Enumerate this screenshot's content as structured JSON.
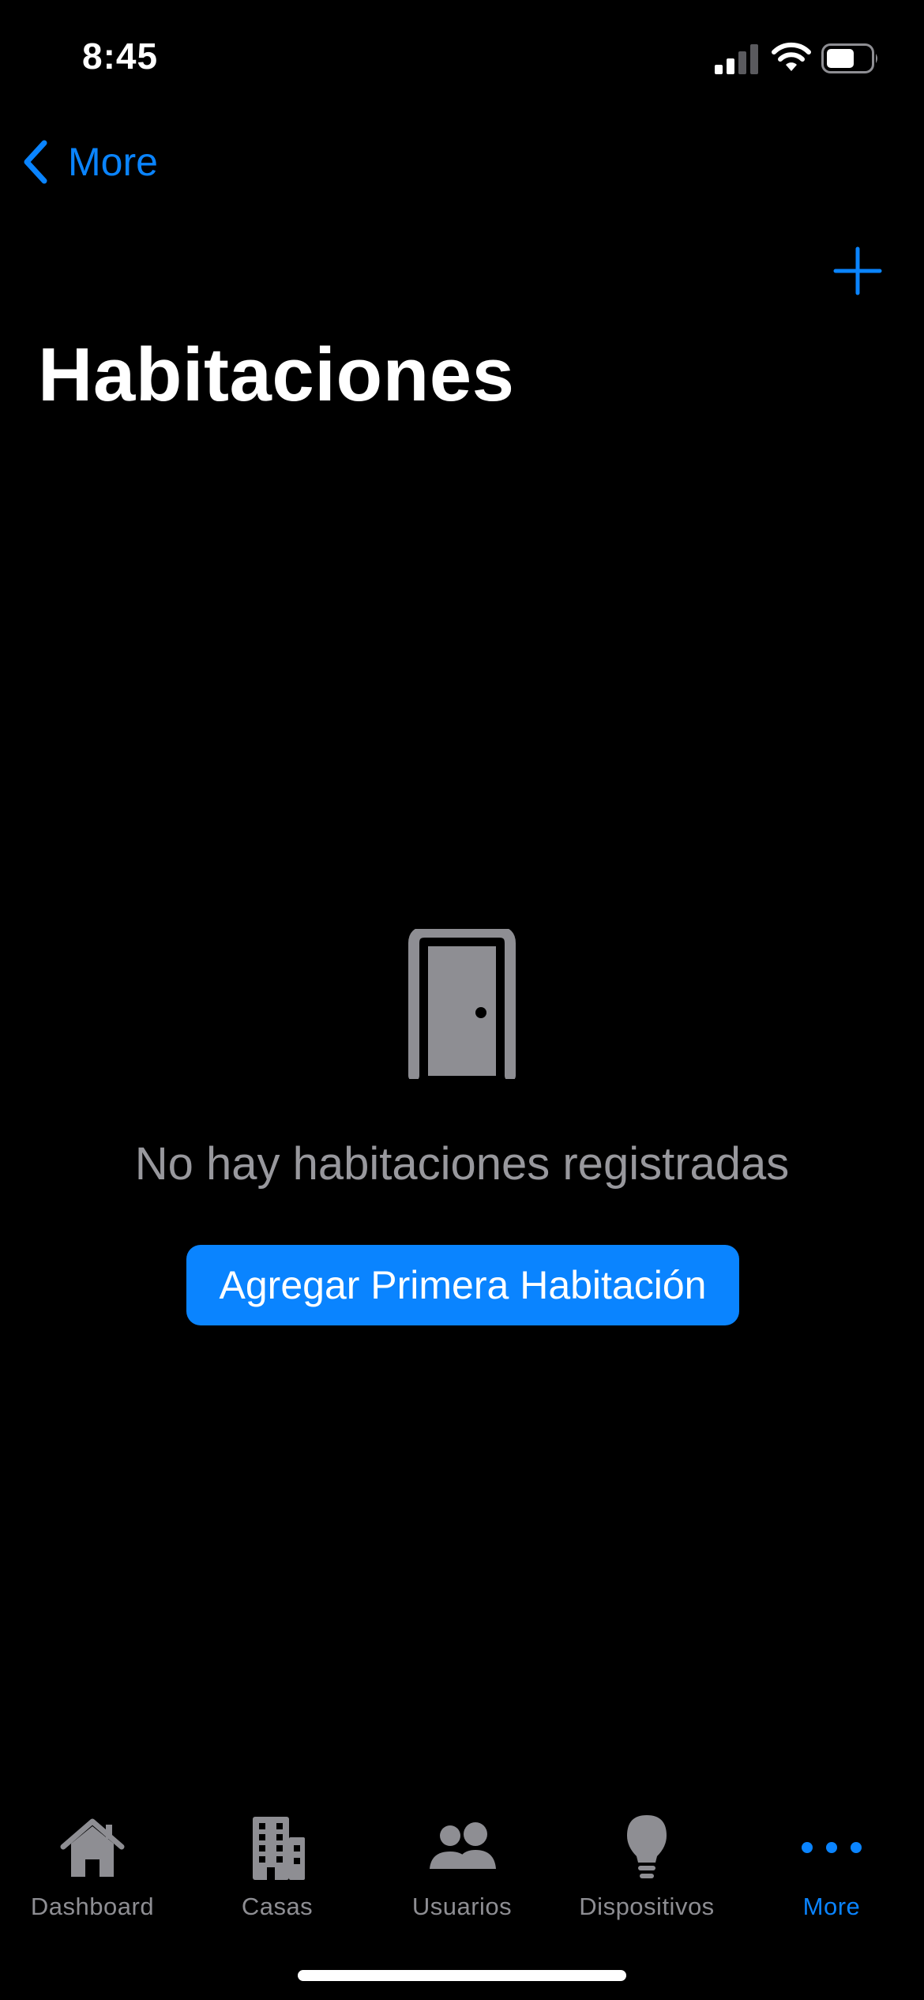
{
  "status_bar": {
    "time": "8:45",
    "icons": [
      "cellular-signal-icon",
      "wifi-icon",
      "battery-icon"
    ]
  },
  "nav": {
    "back_label": "More",
    "back_icon": "chevron-left-icon",
    "add_icon": "plus-icon",
    "title": "Habitaciones"
  },
  "empty_state": {
    "icon": "door-icon",
    "message": "No hay habitaciones registradas",
    "button_label": "Agregar Primera Habitación"
  },
  "tab_bar": {
    "tabs": [
      {
        "label": "Dashboard",
        "icon": "house-icon",
        "active": false
      },
      {
        "label": "Casas",
        "icon": "building-icon",
        "active": false
      },
      {
        "label": "Usuarios",
        "icon": "people-icon",
        "active": false
      },
      {
        "label": "Dispositivos",
        "icon": "lightbulb-icon",
        "active": false
      },
      {
        "label": "More",
        "icon": "ellipsis-icon",
        "active": true
      }
    ]
  },
  "colors": {
    "background": "#000000",
    "accent": "#0a84ff",
    "inactive": "#8e8e93",
    "secondary_text": "#98989d"
  }
}
